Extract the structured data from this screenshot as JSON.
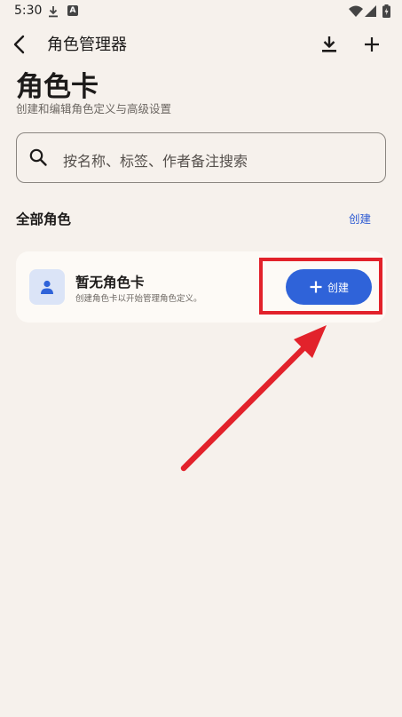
{
  "status_bar": {
    "time": "5:30",
    "icons": [
      "download-icon",
      "app-a-icon",
      "wifi-icon",
      "signal-icon",
      "battery-icon"
    ]
  },
  "app_bar": {
    "title": "角色管理器",
    "icons": [
      "back-arrow-icon",
      "download-icon",
      "plus-icon"
    ]
  },
  "header": {
    "title": "角色卡",
    "subtitle": "创建和编辑角色定义与高级设置"
  },
  "search": {
    "placeholder": "按名称、标签、作者备注搜索"
  },
  "section": {
    "title": "全部角色",
    "action_label": "创建"
  },
  "empty_state": {
    "title": "暂无角色卡",
    "description": "创建角色卡以开始管理角色定义。",
    "button_label": "创建"
  },
  "colors": {
    "background": "#f6f1ec",
    "accent": "#2f63d9",
    "annotation": "#e2222b"
  }
}
